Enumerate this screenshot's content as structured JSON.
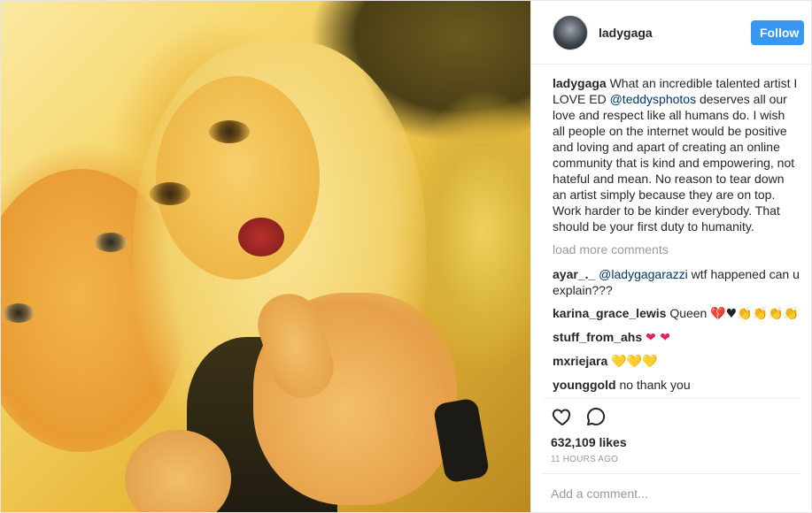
{
  "post": {
    "author": {
      "username": "ladygaga",
      "avatar_icon": "profile-avatar-icon"
    },
    "follow_label": "Follow",
    "photo_icon": "post-photo",
    "caption": {
      "username": "ladygaga",
      "text_before": "What an incredible talented artist I LOVE ED ",
      "mention": "@teddysphotos",
      "text_after": " deserves all our love and respect like all humans do. I wish all people on the internet would be positive and loving and apart of creating an online community that is kind and empowering, not hateful and mean. No reason to tear down an artist simply because they are on top. Work harder to be kinder everybody. That should be your first duty to humanity."
    },
    "load_more": "load more comments",
    "comments": [
      {
        "username": "ayar_._",
        "mention": "@ladygagarazzi",
        "text": " wtf happened can u explain???"
      },
      {
        "username": "karina_grace_lewis",
        "text": "Queen ",
        "emoji": "💔♥👏👏👏👏"
      },
      {
        "username": "stuff_from_ahs",
        "text": "",
        "emoji": "❤❤"
      },
      {
        "username": "mxriejara",
        "text": "",
        "emoji": "💛💛💛"
      },
      {
        "username": "younggold",
        "text": "no thank you"
      }
    ],
    "likes": "632,109 likes",
    "time": "11 HOURS AGO",
    "add_comment_placeholder": "Add a comment...",
    "colors": {
      "follow": "#3897f0",
      "mention": "#003569",
      "muted": "#999999"
    }
  }
}
